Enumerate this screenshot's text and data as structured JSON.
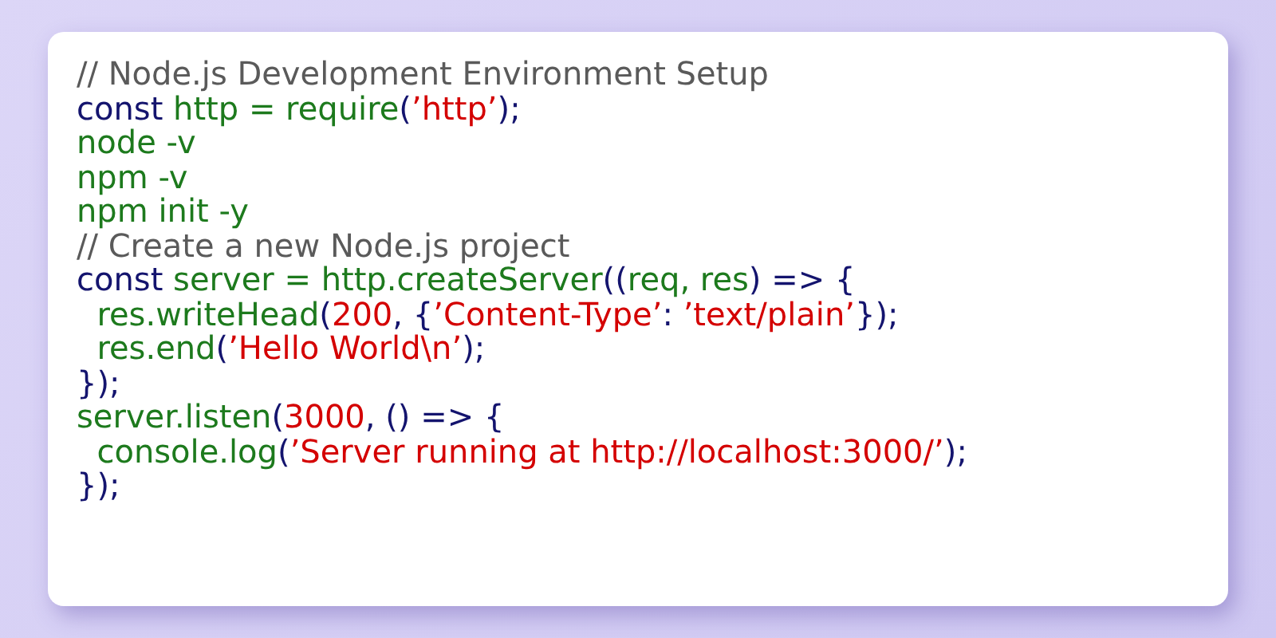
{
  "code_lines": [
    {
      "tokens": [
        {
          "kind": "comment",
          "text": "// Node.js Development Environment Setup"
        }
      ]
    },
    {
      "tokens": [
        {
          "kind": "keyword",
          "text": "const"
        },
        {
          "kind": "name",
          "text": " http = require"
        },
        {
          "kind": "punct",
          "text": "("
        },
        {
          "kind": "string",
          "text": "’http’"
        },
        {
          "kind": "punct",
          "text": ");"
        }
      ]
    },
    {
      "tokens": [
        {
          "kind": "name",
          "text": "node -v"
        }
      ]
    },
    {
      "tokens": [
        {
          "kind": "name",
          "text": "npm -v"
        }
      ]
    },
    {
      "tokens": [
        {
          "kind": "name",
          "text": "npm init -y"
        }
      ]
    },
    {
      "tokens": [
        {
          "kind": "comment",
          "text": "// Create a new Node.js project"
        }
      ]
    },
    {
      "tokens": [
        {
          "kind": "keyword",
          "text": "const"
        },
        {
          "kind": "name",
          "text": " server = http.createServer"
        },
        {
          "kind": "punct",
          "text": "(("
        },
        {
          "kind": "name",
          "text": "req, res"
        },
        {
          "kind": "punct",
          "text": ") => {"
        }
      ]
    },
    {
      "tokens": [
        {
          "kind": "name",
          "text": "  res.writeHead"
        },
        {
          "kind": "punct",
          "text": "("
        },
        {
          "kind": "string",
          "text": "200"
        },
        {
          "kind": "punct",
          "text": ", {"
        },
        {
          "kind": "string",
          "text": "’Content-Type’"
        },
        {
          "kind": "punct",
          "text": ": "
        },
        {
          "kind": "string",
          "text": "’text/plain’"
        },
        {
          "kind": "punct",
          "text": "});"
        }
      ]
    },
    {
      "tokens": [
        {
          "kind": "name",
          "text": "  res.end"
        },
        {
          "kind": "punct",
          "text": "("
        },
        {
          "kind": "string",
          "text": "’Hello World\\n’"
        },
        {
          "kind": "punct",
          "text": ");"
        }
      ]
    },
    {
      "tokens": [
        {
          "kind": "punct",
          "text": "});"
        }
      ]
    },
    {
      "tokens": [
        {
          "kind": "name",
          "text": "server.listen"
        },
        {
          "kind": "punct",
          "text": "("
        },
        {
          "kind": "string",
          "text": "3000"
        },
        {
          "kind": "punct",
          "text": ", () => {"
        }
      ]
    },
    {
      "tokens": [
        {
          "kind": "name",
          "text": "  console.log"
        },
        {
          "kind": "punct",
          "text": "("
        },
        {
          "kind": "string",
          "text": "’Server running at http://localhost:3000/’"
        },
        {
          "kind": "punct",
          "text": ");"
        }
      ]
    },
    {
      "tokens": [
        {
          "kind": "punct",
          "text": "});"
        }
      ]
    }
  ]
}
